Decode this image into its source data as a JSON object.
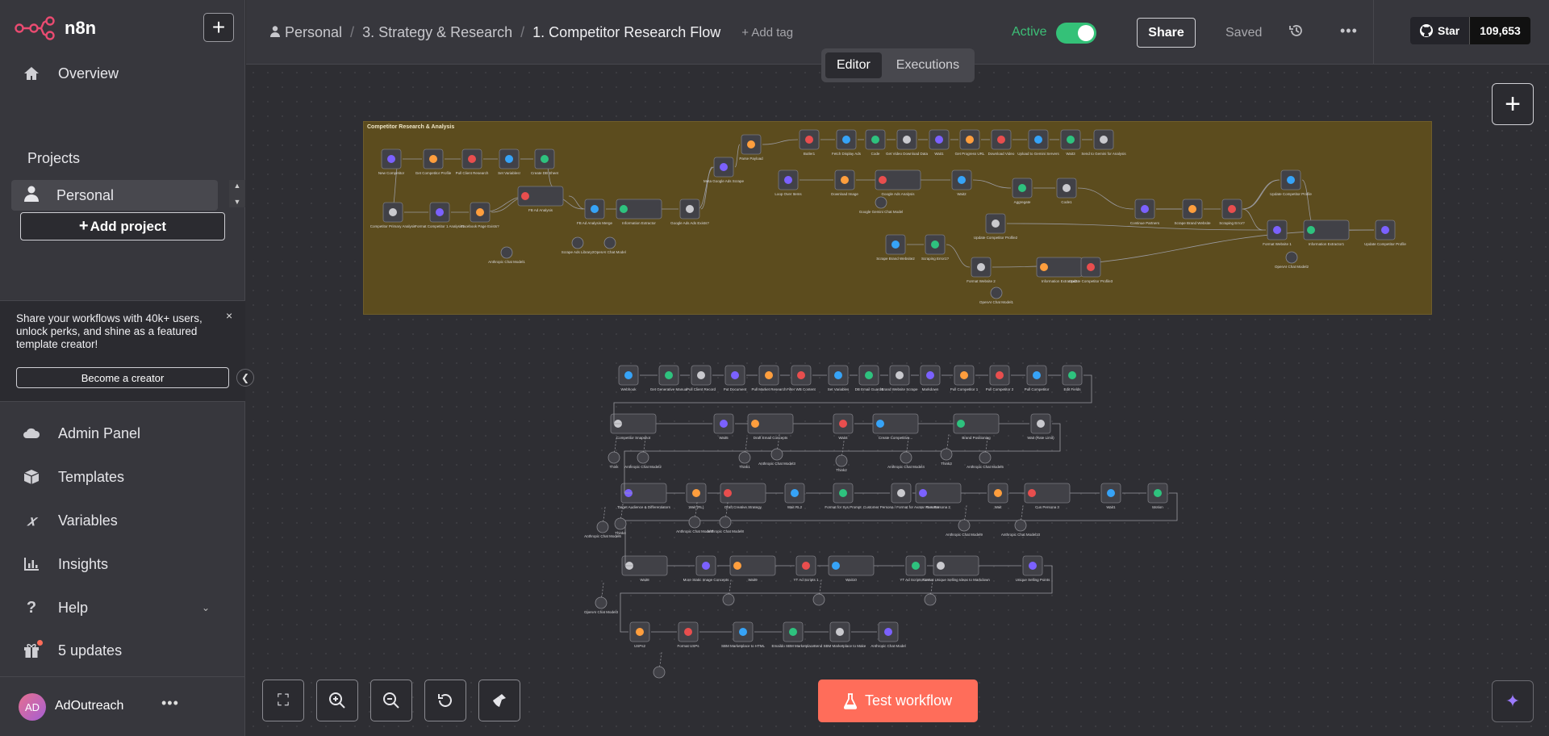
{
  "app": {
    "name": "n8n"
  },
  "sidebar": {
    "overview": "Overview",
    "projects_heading": "Projects",
    "personal": "Personal",
    "add_project": "Add project",
    "promo_text": "Share your workflows with 40k+ users, unlock perks, and shine as a featured template creator!",
    "promo_close": "×",
    "become_creator": "Become a creator",
    "items": [
      {
        "label": "Admin Panel",
        "icon": "cloud-icon"
      },
      {
        "label": "Templates",
        "icon": "box-icon"
      },
      {
        "label": "Variables",
        "icon": "variable-icon"
      },
      {
        "label": "Insights",
        "icon": "chart-icon"
      },
      {
        "label": "Help",
        "icon": "question-icon"
      },
      {
        "label": "5 updates",
        "icon": "gift-icon"
      }
    ],
    "user": {
      "initials": "AD",
      "name": "AdOutreach"
    }
  },
  "header": {
    "breadcrumb": [
      "Personal",
      "3. Strategy & Research",
      "1. Competitor Research Flow"
    ],
    "add_tag": "+ Add tag",
    "active_label": "Active",
    "active": true,
    "share": "Share",
    "saved": "Saved",
    "github_star": "Star",
    "github_count": "109,653"
  },
  "tabs": [
    "Editor",
    "Executions"
  ],
  "canvas": {
    "sticky_title": "Competitor Research & Analysis",
    "test_button": "Test workflow",
    "sticky_nodes": [
      "New Competitor",
      "Get Competitor Profile",
      "Pull Client Research",
      "Set Variables!",
      "Create DB Sheet",
      "Competitor Primary Analysis",
      "Format Competitor 1 Analysis1",
      "Facebook Page Exists?",
      "FB Ad Analysis",
      "FB Ad Analysis Merge",
      "Information Extractor",
      "Google Ads Ads Exists?",
      "Meta Google Ads Scrape",
      "Parse Payload",
      "Butler1",
      "Fetch Display Ads",
      "Code",
      "Get Video Download Data",
      "Wait1",
      "Get Progress URL",
      "Download Video",
      "Upload to Gemini Servers",
      "Wait3",
      "Send to Gemini for Analysis",
      "Loop Over Items",
      "Download Image",
      "Google Ads Analysis",
      "Wait2",
      "Aggregate",
      "Code1",
      "Continue Partners",
      "Scrape Brand Website",
      "Scraping Error?",
      "Update Competitor Profile",
      "Information Extractor1",
      "Update Competitor Profile2",
      "Format Website 1",
      "Information Extractor2",
      "Update Competitor Profile3",
      "Scrape Brand Website2",
      "Scraping Error1?",
      "Format Website 2",
      "Update Competitor Profile",
      "Google Gemini Chat Model",
      "Anthropic Chat Model1",
      "Scrape Ads Library2",
      "OpenAI Chat Model",
      "OpenAI Chat Model1",
      "OpenAI Chat Model2"
    ],
    "flow_nodes": [
      "Webhook",
      "Get Generative Manual",
      "Pull Client Record",
      "Put Document",
      "Pull Market Research",
      "Filter WB Content",
      "Set Variables",
      "DB Email Guards",
      "Brand Website Scrape",
      "Markdown",
      "Pull Competitor 1",
      "Pull Competitor 2",
      "Pull Competitor",
      "Edit Fields",
      "Competitor Snapshot",
      "Wait5",
      "Draft Email Concepts",
      "Wait4",
      "Create Competitive...",
      "Brand Positioning",
      "Wait (Rate Limit)",
      "Target Audience & Differentiators",
      "Wait (RL)",
      "Draft Creative Strategy",
      "Wait RL2",
      "Format for Sys Prompt",
      "Customer Persona / Format for Avatar Persona",
      "Cus Persona 2",
      "Wait",
      "Cus Persona 3",
      "Wait1",
      "Motion",
      "Wait8",
      "More Static Image Concepts",
      "Wait9",
      "YT Ad Scripts 1",
      "Wait10",
      "YT Ad Scripts Cont.",
      "Format Unique Selling Ideas to Markdown",
      "Unique Selling Points",
      "USPs2",
      "Format USPs",
      "SBM Marketplace to HTML",
      "Emaildo SBM Marketplace",
      "Send SBM Marketplace to Make",
      "Anthropic Chat Model",
      "Think",
      "Anthropic Chat Model2",
      "Think1",
      "Anthropic Chat Model3",
      "Think2",
      "Anthropic Chat Model4",
      "Think3",
      "Anthropic Chat Model5",
      "Anthropic Chat Model6",
      "Think4",
      "Anthropic Chat Model7",
      "Anthropic Chat Model8",
      "Anthropic Chat Model9",
      "Anthropic Chat Model10",
      "OpenAI Chat Model3"
    ]
  },
  "colors": {
    "accent": "#ff6d5a",
    "active": "#34c178",
    "sticky": "#5c4c1e",
    "canvas": "#2e2e33"
  }
}
